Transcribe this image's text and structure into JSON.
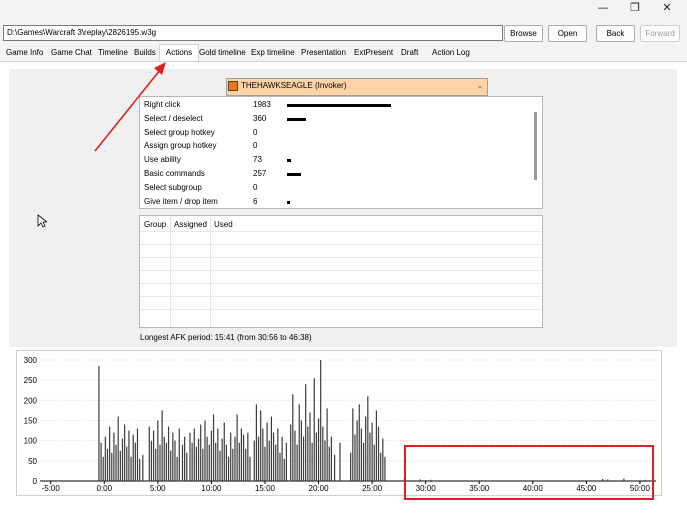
{
  "window": {
    "minimize_glyph": "—",
    "maximize_glyph": "❐",
    "close_glyph": "✕"
  },
  "toolbar": {
    "path_value": "D:\\Games\\Warcraft 3\\replay\\2826195.w3g",
    "browse_label": "Browse",
    "open_label": "Open",
    "back_label": "Back",
    "forward_label": "Forward"
  },
  "tabs": [
    {
      "label": "Game Info"
    },
    {
      "label": "Game Chat"
    },
    {
      "label": "Timeline"
    },
    {
      "label": "Builds"
    },
    {
      "label": "Actions",
      "active": true
    },
    {
      "label": "Gold timeline"
    },
    {
      "label": "Exp timeline"
    },
    {
      "label": "Presentation"
    },
    {
      "label": "ExtPresent"
    },
    {
      "label": "Draft"
    },
    {
      "label": "Action Log"
    }
  ],
  "player_select": {
    "selected": "THEHAWKSEAGLE (Invoker)",
    "icon": "hero-portrait-icon",
    "color": "#fcd4a8"
  },
  "actions": [
    {
      "name": "Right click",
      "value": "1983",
      "bar_fraction": 1.0
    },
    {
      "name": "Select / deselect",
      "value": "360",
      "bar_fraction": 0.18
    },
    {
      "name": "Select group hotkey",
      "value": "0",
      "bar_fraction": 0
    },
    {
      "name": "Assign group hotkey",
      "value": "0",
      "bar_fraction": 0
    },
    {
      "name": "Use ability",
      "value": "73",
      "bar_fraction": 0.04
    },
    {
      "name": "Basic commands",
      "value": "257",
      "bar_fraction": 0.13
    },
    {
      "name": "Select subgroup",
      "value": "0",
      "bar_fraction": 0
    },
    {
      "name": "Give item / drop item",
      "value": "6",
      "bar_fraction": 0.003
    }
  ],
  "group_table": {
    "headers": [
      "Group",
      "Assigned",
      "Used"
    ]
  },
  "afk_text": "Longest AFK period: 15:41 (from 30:56 to 46:38)",
  "chart_data": {
    "type": "bar",
    "ylim": [
      0,
      300
    ],
    "yticks": [
      "300",
      "250",
      "200",
      "150",
      "100",
      "50",
      "0"
    ],
    "xticks": [
      "-5:00",
      "0:00",
      "5:00",
      "10:00",
      "15:00",
      "20:00",
      "25:00",
      "30:00",
      "35:00",
      "40:00",
      "45:00",
      "50:00"
    ],
    "xtick_minutes": [
      -5,
      0,
      5,
      10,
      15,
      20,
      25,
      30,
      35,
      40,
      45,
      50
    ],
    "xlim_minutes": [
      -6,
      51.5
    ],
    "bar_color": "#3c3c3c",
    "values": [
      {
        "t": -0.5,
        "v": 285
      },
      {
        "t": -0.3,
        "v": 95
      },
      {
        "t": -0.1,
        "v": 60
      },
      {
        "t": 0.1,
        "v": 110
      },
      {
        "t": 0.3,
        "v": 80
      },
      {
        "t": 0.5,
        "v": 135
      },
      {
        "t": 0.7,
        "v": 70
      },
      {
        "t": 0.9,
        "v": 120
      },
      {
        "t": 1.1,
        "v": 90
      },
      {
        "t": 1.3,
        "v": 160
      },
      {
        "t": 1.5,
        "v": 75
      },
      {
        "t": 1.7,
        "v": 105
      },
      {
        "t": 1.9,
        "v": 140
      },
      {
        "t": 2.1,
        "v": 85
      },
      {
        "t": 2.3,
        "v": 125
      },
      {
        "t": 2.5,
        "v": 60
      },
      {
        "t": 2.7,
        "v": 115
      },
      {
        "t": 2.9,
        "v": 95
      },
      {
        "t": 3.1,
        "v": 130
      },
      {
        "t": 3.3,
        "v": 55
      },
      {
        "t": 3.6,
        "v": 65
      },
      {
        "t": 4.2,
        "v": 135
      },
      {
        "t": 4.4,
        "v": 100
      },
      {
        "t": 4.6,
        "v": 125
      },
      {
        "t": 4.8,
        "v": 80
      },
      {
        "t": 5.0,
        "v": 150
      },
      {
        "t": 5.2,
        "v": 90
      },
      {
        "t": 5.4,
        "v": 175
      },
      {
        "t": 5.6,
        "v": 110
      },
      {
        "t": 5.8,
        "v": 95
      },
      {
        "t": 6.0,
        "v": 135
      },
      {
        "t": 6.2,
        "v": 75
      },
      {
        "t": 6.4,
        "v": 120
      },
      {
        "t": 6.6,
        "v": 100
      },
      {
        "t": 6.8,
        "v": 60
      },
      {
        "t": 7.0,
        "v": 130
      },
      {
        "t": 7.3,
        "v": 90
      },
      {
        "t": 7.5,
        "v": 110
      },
      {
        "t": 7.7,
        "v": 70
      },
      {
        "t": 8.0,
        "v": 120
      },
      {
        "t": 8.2,
        "v": 95
      },
      {
        "t": 8.4,
        "v": 130
      },
      {
        "t": 8.6,
        "v": 85
      },
      {
        "t": 8.8,
        "v": 105
      },
      {
        "t": 9.0,
        "v": 140
      },
      {
        "t": 9.2,
        "v": 80
      },
      {
        "t": 9.4,
        "v": 150
      },
      {
        "t": 9.6,
        "v": 110
      },
      {
        "t": 9.8,
        "v": 90
      },
      {
        "t": 10.0,
        "v": 125
      },
      {
        "t": 10.2,
        "v": 165
      },
      {
        "t": 10.4,
        "v": 95
      },
      {
        "t": 10.6,
        "v": 130
      },
      {
        "t": 10.8,
        "v": 75
      },
      {
        "t": 11.0,
        "v": 105
      },
      {
        "t": 11.2,
        "v": 145
      },
      {
        "t": 11.4,
        "v": 90
      },
      {
        "t": 11.6,
        "v": 60
      },
      {
        "t": 11.8,
        "v": 120
      },
      {
        "t": 12.0,
        "v": 80
      },
      {
        "t": 12.2,
        "v": 110
      },
      {
        "t": 12.4,
        "v": 165
      },
      {
        "t": 12.6,
        "v": 95
      },
      {
        "t": 12.8,
        "v": 130
      },
      {
        "t": 13.0,
        "v": 115
      },
      {
        "t": 13.2,
        "v": 80
      },
      {
        "t": 13.4,
        "v": 120
      },
      {
        "t": 13.6,
        "v": 60
      },
      {
        "t": 14.0,
        "v": 100
      },
      {
        "t": 14.2,
        "v": 190
      },
      {
        "t": 14.4,
        "v": 110
      },
      {
        "t": 14.6,
        "v": 175
      },
      {
        "t": 14.8,
        "v": 130
      },
      {
        "t": 15.0,
        "v": 85
      },
      {
        "t": 15.2,
        "v": 145
      },
      {
        "t": 15.4,
        "v": 100
      },
      {
        "t": 15.6,
        "v": 160
      },
      {
        "t": 15.8,
        "v": 120
      },
      {
        "t": 16.0,
        "v": 90
      },
      {
        "t": 16.2,
        "v": 130
      },
      {
        "t": 16.4,
        "v": 70
      },
      {
        "t": 16.6,
        "v": 110
      },
      {
        "t": 16.8,
        "v": 55
      },
      {
        "t": 17.0,
        "v": 95
      },
      {
        "t": 17.4,
        "v": 140
      },
      {
        "t": 17.6,
        "v": 215
      },
      {
        "t": 17.8,
        "v": 125
      },
      {
        "t": 18.0,
        "v": 90
      },
      {
        "t": 18.2,
        "v": 190
      },
      {
        "t": 18.4,
        "v": 150
      },
      {
        "t": 18.6,
        "v": 110
      },
      {
        "t": 18.8,
        "v": 240
      },
      {
        "t": 19.0,
        "v": 135
      },
      {
        "t": 19.2,
        "v": 170
      },
      {
        "t": 19.4,
        "v": 95
      },
      {
        "t": 19.6,
        "v": 255
      },
      {
        "t": 19.8,
        "v": 120
      },
      {
        "t": 20.0,
        "v": 155
      },
      {
        "t": 20.2,
        "v": 300
      },
      {
        "t": 20.4,
        "v": 135
      },
      {
        "t": 20.6,
        "v": 100
      },
      {
        "t": 20.8,
        "v": 180
      },
      {
        "t": 21.0,
        "v": 85
      },
      {
        "t": 21.2,
        "v": 110
      },
      {
        "t": 21.5,
        "v": 65
      },
      {
        "t": 22.0,
        "v": 95
      },
      {
        "t": 23.0,
        "v": 70
      },
      {
        "t": 23.2,
        "v": 180
      },
      {
        "t": 23.4,
        "v": 115
      },
      {
        "t": 23.6,
        "v": 150
      },
      {
        "t": 23.8,
        "v": 190
      },
      {
        "t": 24.0,
        "v": 130
      },
      {
        "t": 24.2,
        "v": 95
      },
      {
        "t": 24.4,
        "v": 160
      },
      {
        "t": 24.6,
        "v": 210
      },
      {
        "t": 24.8,
        "v": 120
      },
      {
        "t": 25.0,
        "v": 145
      },
      {
        "t": 25.2,
        "v": 90
      },
      {
        "t": 25.4,
        "v": 175
      },
      {
        "t": 25.6,
        "v": 135
      },
      {
        "t": 25.8,
        "v": 70
      },
      {
        "t": 26.0,
        "v": 105
      },
      {
        "t": 26.2,
        "v": 60
      },
      {
        "t": 28.0,
        "v": 6
      },
      {
        "t": 29.5,
        "v": 4
      },
      {
        "t": 30.5,
        "v": 3
      },
      {
        "t": 46.5,
        "v": 5
      },
      {
        "t": 47.0,
        "v": 4
      },
      {
        "t": 48.5,
        "v": 6
      },
      {
        "t": 50.5,
        "v": 3
      }
    ]
  },
  "annotations": {
    "arrow_color": "#e02020",
    "highlight_color": "#e02020"
  }
}
